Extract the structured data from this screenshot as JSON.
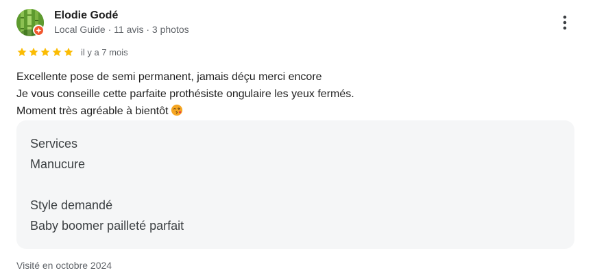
{
  "reviewer": {
    "name": "Elodie Godé",
    "meta": "Local Guide · 11 avis · 3 photos",
    "avatar_icon": "bamboo-avatar",
    "badge_icon": "local-guide-star-icon"
  },
  "rating": {
    "stars": 5,
    "max": 5,
    "date": "il y a 7 mois",
    "star_color": "#fbbc04"
  },
  "review": {
    "lines": [
      "Excellente pose de semi permanent, jamais déçu merci encore",
      "Je vous conseille cette parfaite prothésiste ongulaire les yeux fermés.",
      "Moment très agréable à bientôt"
    ],
    "emoji_icon": "face-blowing-kiss-icon"
  },
  "details": [
    {
      "label": "Services",
      "value": "Manucure"
    },
    {
      "label": "Style demandé",
      "value": "Baby boomer pailleté parfait"
    }
  ],
  "visited": "Visité en octobre 2024",
  "menu_icon": "more-vert-icon",
  "colors": {
    "text_primary": "#1f1f1f",
    "text_secondary": "#5f6368",
    "panel_bg": "#f5f6f7",
    "badge": "#f1582f"
  }
}
